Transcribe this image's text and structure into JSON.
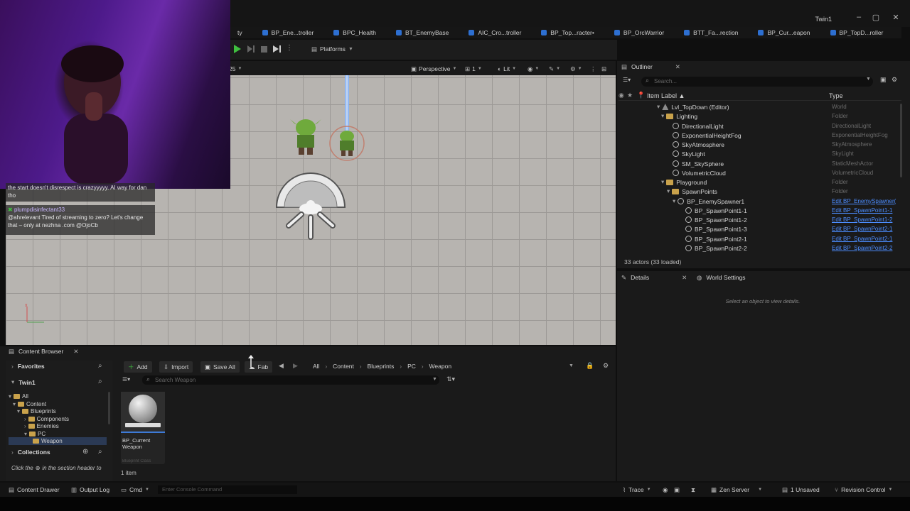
{
  "window": {
    "title": "Twin1"
  },
  "tabs": [
    {
      "label": "ty"
    },
    {
      "label": "BP_Ene...troller"
    },
    {
      "label": "BPC_Health"
    },
    {
      "label": "BT_EnemyBase"
    },
    {
      "label": "AIC_Cro...troller"
    },
    {
      "label": "BP_Top...racter•"
    },
    {
      "label": "BP_OrcWarrior"
    },
    {
      "label": "BTT_Fa...rection"
    },
    {
      "label": "BP_Cur...eapon"
    },
    {
      "label": "BP_TopD...roller"
    }
  ],
  "toolbar": {
    "platforms_label": "Platforms"
  },
  "viewport": {
    "perspective_label": "Perspective",
    "lit_label": "Lit",
    "fov_label": "1",
    "tail_label": "25"
  },
  "chat": {
    "partial_msg": "the start doesn't disrespect is crazyyyyy. AI way for dan tho",
    "user": "plumpdisinfectant33",
    "message": "@ahrelevant Tired of streaming to zero? Let's change that – only at nezhna .com @OjoCb"
  },
  "outliner": {
    "title": "Outliner",
    "search_placeholder": "Search...",
    "col_label": "Item Label ▲",
    "col_type": "Type",
    "rows": [
      {
        "label": "Lvl_TopDown (Editor)",
        "type": "World"
      },
      {
        "label": "Lighting",
        "type": "Folder"
      },
      {
        "label": "DirectionalLight",
        "type": "DirectionalLight"
      },
      {
        "label": "ExponentialHeightFog",
        "type": "ExponentialHeightFog"
      },
      {
        "label": "SkyAtmosphere",
        "type": "SkyAtmosphere"
      },
      {
        "label": "SkyLight",
        "type": "SkyLight"
      },
      {
        "label": "SM_SkySphere",
        "type": "StaticMeshActor"
      },
      {
        "label": "VolumetricCloud",
        "type": "VolumetricCloud"
      },
      {
        "label": "Playground",
        "type": "Folder"
      },
      {
        "label": "SpawnPoints",
        "type": "Folder"
      },
      {
        "label": "BP_EnemySpawner1",
        "type": "Edit BP_EnemySpawner("
      },
      {
        "label": "BP_SpawnPoint1-1",
        "type": "Edit BP_SpawnPoint1-1"
      },
      {
        "label": "BP_SpawnPoint1-2",
        "type": "Edit BP_SpawnPoint1-2"
      },
      {
        "label": "BP_SpawnPoint1-3",
        "type": "Edit BP_SpawnPoint2-1"
      },
      {
        "label": "BP_SpawnPoint2-1",
        "type": "Edit BP_SpawnPoint2-1"
      },
      {
        "label": "BP_SpawnPoint2-2",
        "type": "Edit BP_SpawnPoint2-2"
      }
    ],
    "actor_count": "33 actors (33 loaded)"
  },
  "details": {
    "tab_details": "Details",
    "tab_world": "World Settings",
    "empty_msg": "Select an object to view details."
  },
  "content_browser": {
    "title": "Content Browser",
    "add": "Add",
    "import": "Import",
    "save_all": "Save All",
    "fab": "Fab",
    "breadcrumb": [
      "All",
      "Content",
      "Blueprints",
      "PC",
      "Weapon"
    ],
    "search_placeholder": "Search Weapon",
    "favorites": "Favorites",
    "project": "Twin1",
    "tree": [
      "All",
      "Content",
      "Blueprints",
      "Components",
      "Enemies",
      "PC",
      "Weapon"
    ],
    "collections": "Collections",
    "collections_hint_a": "Click the",
    "collections_hint_b": "in the section header to",
    "asset_name": "BP_Current Weapon",
    "asset_class": "Blueprint Class",
    "item_count": "1 item"
  },
  "statusbar": {
    "content_drawer": "Content Drawer",
    "output_log": "Output Log",
    "cmd": "Cmd",
    "console_placeholder": "Enter Console Command",
    "trace": "Trace",
    "zen_server": "Zen Server",
    "unsaved": "1 Unsaved",
    "revision_control": "Revision Control"
  }
}
